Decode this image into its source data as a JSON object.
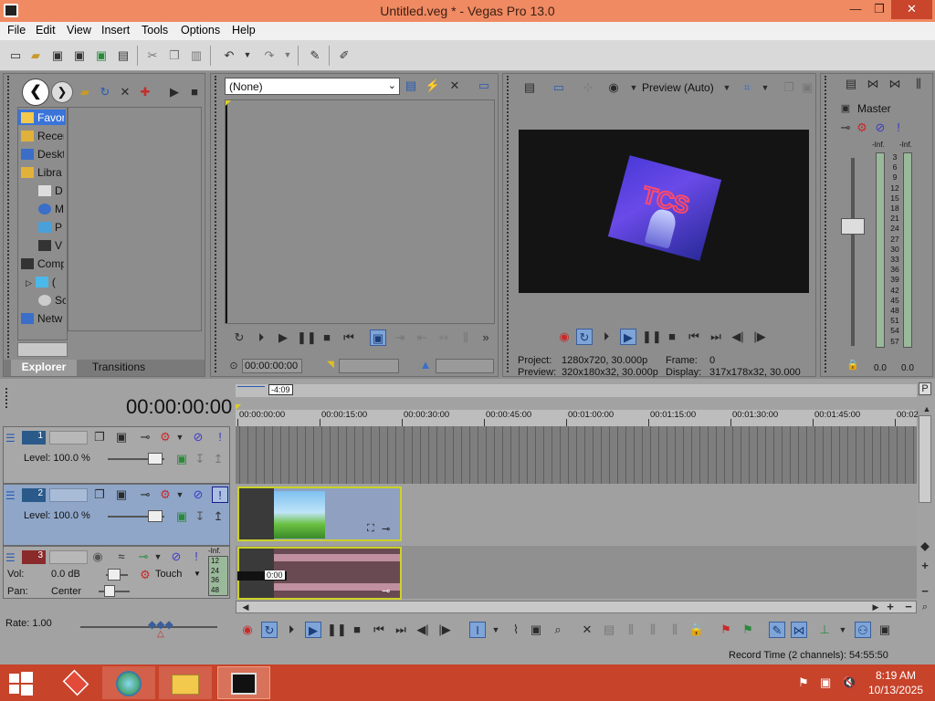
{
  "window": {
    "title": "Untitled.veg * - Vegas Pro 13.0",
    "minimize": "—",
    "maximize": "❐",
    "close": "✕"
  },
  "menu": [
    "File",
    "Edit",
    "View",
    "Insert",
    "Tools",
    "Options",
    "Help"
  ],
  "explorer": {
    "tree": [
      "Favor",
      "Recen",
      "Deskt",
      "Libra",
      "D",
      "M",
      "P",
      "V",
      "Comp",
      "(",
      "Sc",
      "Netw"
    ],
    "tabs": [
      "Explorer",
      "Transitions"
    ]
  },
  "trimmer": {
    "preset": "(None)",
    "timecode": "00:00:00:00"
  },
  "preview": {
    "mode": "Preview (Auto)",
    "project_label": "Project:",
    "project_value": "1280x720, 30.000p",
    "preview_label": "Preview:",
    "preview_value": "320x180x32, 30.000p",
    "frame_label": "Frame:",
    "frame_value": "0",
    "display_label": "Display:",
    "display_value": "317x178x32, 30.000"
  },
  "master": {
    "title": "Master",
    "inf_left": "-Inf.",
    "inf_right": "-Inf.",
    "scale": [
      "3",
      "6",
      "9",
      "12",
      "15",
      "18",
      "21",
      "24",
      "27",
      "30",
      "33",
      "36",
      "39",
      "42",
      "45",
      "48",
      "51",
      "54",
      "57"
    ],
    "bottom_left": "0.0",
    "bottom_right": "0.0"
  },
  "timeline": {
    "timecode": "00:00:00:00",
    "marker": "-4:09",
    "ruler": [
      "00:00:00:00",
      "00:00:15:00",
      "00:00:30:00",
      "00:00:45:00",
      "00:01:00:00",
      "00:01:15:00",
      "00:01:30:00",
      "00:01:45:00",
      "00:02"
    ],
    "tracks": [
      {
        "num": "1",
        "level": "Level: 100.0 %"
      },
      {
        "num": "2",
        "level": "Level: 100.0 %"
      },
      {
        "num": "3",
        "vol_label": "Vol:",
        "vol": "0.0 dB",
        "pan_label": "Pan:",
        "pan": "Center",
        "touch": "Touch",
        "inf": "-Inf.",
        "meter": [
          "12",
          "24",
          "36",
          "48"
        ]
      }
    ],
    "audio_clip_time": "0:00",
    "rate": "Rate: 1.00",
    "record_time": "Record Time (2 channels): 54:55:50"
  },
  "taskbar": {
    "time": "8:19 AM",
    "date": "10/13/2025"
  },
  "colors": {
    "title_bar": "#f08a63",
    "taskbar": "#c7432a",
    "clip_border": "#ccd227",
    "selected_track": "#8fa6c8"
  }
}
